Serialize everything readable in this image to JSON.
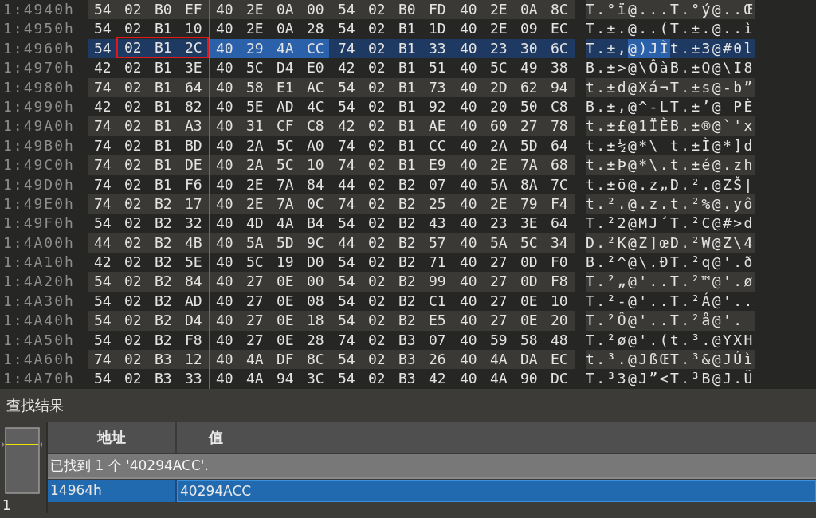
{
  "hex_view": {
    "rows": [
      {
        "address": "1:4940h",
        "selected": false,
        "bytes": [
          "54",
          "02",
          "B0",
          "EF",
          "40",
          "2E",
          "0A",
          "00",
          "54",
          "02",
          "B0",
          "FD",
          "40",
          "2E",
          "0A",
          "8C"
        ],
        "text": "T.°ï@...T.°ý@..Œ"
      },
      {
        "address": "1:4950h",
        "selected": false,
        "bytes": [
          "54",
          "02",
          "B1",
          "10",
          "40",
          "2E",
          "0A",
          "28",
          "54",
          "02",
          "B1",
          "1D",
          "40",
          "2E",
          "09",
          "EC"
        ],
        "text": "T.±.@..(T.±.@..ì"
      },
      {
        "address": "1:4960h",
        "selected": true,
        "bytes": [
          {
            "text": "54",
            "found": false,
            "boxed": false
          },
          {
            "text": "02",
            "found": false,
            "boxed": true
          },
          {
            "text": "B1",
            "found": false,
            "boxed": true
          },
          {
            "text": "2C",
            "found": false,
            "boxed": true
          },
          {
            "text": "40",
            "found": true,
            "boxed": false
          },
          {
            "text": "29",
            "found": true,
            "boxed": false
          },
          {
            "text": "4A",
            "found": true,
            "boxed": false
          },
          {
            "text": "CC",
            "found": true,
            "boxed": false
          },
          "74",
          "02",
          "B1",
          "33",
          "40",
          "23",
          "30",
          "6C"
        ],
        "text": [
          {
            "text": "T.±,",
            "found": false
          },
          {
            "text": "@)JÌ",
            "found": true
          },
          {
            "text": "t.±3@#0l",
            "found": false
          }
        ]
      },
      {
        "address": "1:4970h",
        "selected": false,
        "bytes": [
          "42",
          "02",
          "B1",
          "3E",
          "40",
          "5C",
          "D4",
          "E0",
          "42",
          "02",
          "B1",
          "51",
          "40",
          "5C",
          "49",
          "38"
        ],
        "text": "B.±>@\\ÔàB.±Q@\\I8"
      },
      {
        "address": "1:4980h",
        "selected": false,
        "bytes": [
          "74",
          "02",
          "B1",
          "64",
          "40",
          "58",
          "E1",
          "AC",
          "54",
          "02",
          "B1",
          "73",
          "40",
          "2D",
          "62",
          "94"
        ],
        "text": "t.±d@Xá¬T.±s@-b”"
      },
      {
        "address": "1:4990h",
        "selected": false,
        "bytes": [
          "42",
          "02",
          "B1",
          "82",
          "40",
          "5E",
          "AD",
          "4C",
          "54",
          "02",
          "B1",
          "92",
          "40",
          "20",
          "50",
          "C8"
        ],
        "text": "B.±,@^-LT.±’@ PÈ"
      },
      {
        "address": "1:49A0h",
        "selected": false,
        "bytes": [
          "74",
          "02",
          "B1",
          "A3",
          "40",
          "31",
          "CF",
          "C8",
          "42",
          "02",
          "B1",
          "AE",
          "40",
          "60",
          "27",
          "78"
        ],
        "text": "t.±£@1ÏÈB.±®@`'x"
      },
      {
        "address": "1:49B0h",
        "selected": false,
        "bytes": [
          "74",
          "02",
          "B1",
          "BD",
          "40",
          "2A",
          "5C",
          "A0",
          "74",
          "02",
          "B1",
          "CC",
          "40",
          "2A",
          "5D",
          "64"
        ],
        "text": "t.±½@*\\ t.±Ì@*]d"
      },
      {
        "address": "1:49C0h",
        "selected": false,
        "bytes": [
          "74",
          "02",
          "B1",
          "DE",
          "40",
          "2A",
          "5C",
          "10",
          "74",
          "02",
          "B1",
          "E9",
          "40",
          "2E",
          "7A",
          "68"
        ],
        "text": "t.±Þ@*\\.t.±é@.zh"
      },
      {
        "address": "1:49D0h",
        "selected": false,
        "bytes": [
          "74",
          "02",
          "B1",
          "F6",
          "40",
          "2E",
          "7A",
          "84",
          "44",
          "02",
          "B2",
          "07",
          "40",
          "5A",
          "8A",
          "7C"
        ],
        "text": "t.±ö@.z„D.².@ZŠ|"
      },
      {
        "address": "1:49E0h",
        "selected": false,
        "bytes": [
          "74",
          "02",
          "B2",
          "17",
          "40",
          "2E",
          "7A",
          "0C",
          "74",
          "02",
          "B2",
          "25",
          "40",
          "2E",
          "79",
          "F4"
        ],
        "text": "t.².@.z.t.²%@.yô"
      },
      {
        "address": "1:49F0h",
        "selected": false,
        "bytes": [
          "54",
          "02",
          "B2",
          "32",
          "40",
          "4D",
          "4A",
          "B4",
          "54",
          "02",
          "B2",
          "43",
          "40",
          "23",
          "3E",
          "64"
        ],
        "text": "T.²2@MJ´T.²C@#>d"
      },
      {
        "address": "1:4A00h",
        "selected": false,
        "bytes": [
          "44",
          "02",
          "B2",
          "4B",
          "40",
          "5A",
          "5D",
          "9C",
          "44",
          "02",
          "B2",
          "57",
          "40",
          "5A",
          "5C",
          "34"
        ],
        "text": "D.²K@Z]œD.²W@Z\\4"
      },
      {
        "address": "1:4A10h",
        "selected": false,
        "bytes": [
          "42",
          "02",
          "B2",
          "5E",
          "40",
          "5C",
          "19",
          "D0",
          "54",
          "02",
          "B2",
          "71",
          "40",
          "27",
          "0D",
          "F0"
        ],
        "text": "B.²^@\\.ÐT.²q@'.ð"
      },
      {
        "address": "1:4A20h",
        "selected": false,
        "bytes": [
          "54",
          "02",
          "B2",
          "84",
          "40",
          "27",
          "0E",
          "00",
          "54",
          "02",
          "B2",
          "99",
          "40",
          "27",
          "0D",
          "F8"
        ],
        "text": "T.²„@'..T.²™@'.ø"
      },
      {
        "address": "1:4A30h",
        "selected": false,
        "bytes": [
          "54",
          "02",
          "B2",
          "AD",
          "40",
          "27",
          "0E",
          "08",
          "54",
          "02",
          "B2",
          "C1",
          "40",
          "27",
          "0E",
          "10"
        ],
        "text": "T.²-@'..T.²Á@'.."
      },
      {
        "address": "1:4A40h",
        "selected": false,
        "bytes": [
          "54",
          "02",
          "B2",
          "D4",
          "40",
          "27",
          "0E",
          "18",
          "54",
          "02",
          "B2",
          "E5",
          "40",
          "27",
          "0E",
          "20"
        ],
        "text": "T.²Ô@'..T.²å@'."
      },
      {
        "address": "1:4A50h",
        "selected": false,
        "bytes": [
          "54",
          "02",
          "B2",
          "F8",
          "40",
          "27",
          "0E",
          "28",
          "74",
          "02",
          "B3",
          "07",
          "40",
          "59",
          "58",
          "48"
        ],
        "text": "T.²ø@'.(t.³.@YXH"
      },
      {
        "address": "1:4A60h",
        "selected": false,
        "bytes": [
          "74",
          "02",
          "B3",
          "12",
          "40",
          "4A",
          "DF",
          "8C",
          "54",
          "02",
          "B3",
          "26",
          "40",
          "4A",
          "DA",
          "EC"
        ],
        "text": "t.³.@JßŒT.³&@JÚì"
      },
      {
        "address": "1:4A70h",
        "selected": false,
        "bytes": [
          "54",
          "02",
          "B3",
          "33",
          "40",
          "4A",
          "94",
          "3C",
          "54",
          "02",
          "B3",
          "42",
          "40",
          "4A",
          "90",
          "DC"
        ],
        "text": "T.³3@J”<T.³B@J.Ü"
      }
    ]
  },
  "results_panel": {
    "title": "查找结果",
    "counter": "1",
    "columns": [
      "地址",
      "值"
    ],
    "group_label": "已找到 1 个 '40294ACC'.",
    "rows": [
      {
        "address": "14964h",
        "value": "40294ACC",
        "selected": true
      }
    ]
  }
}
